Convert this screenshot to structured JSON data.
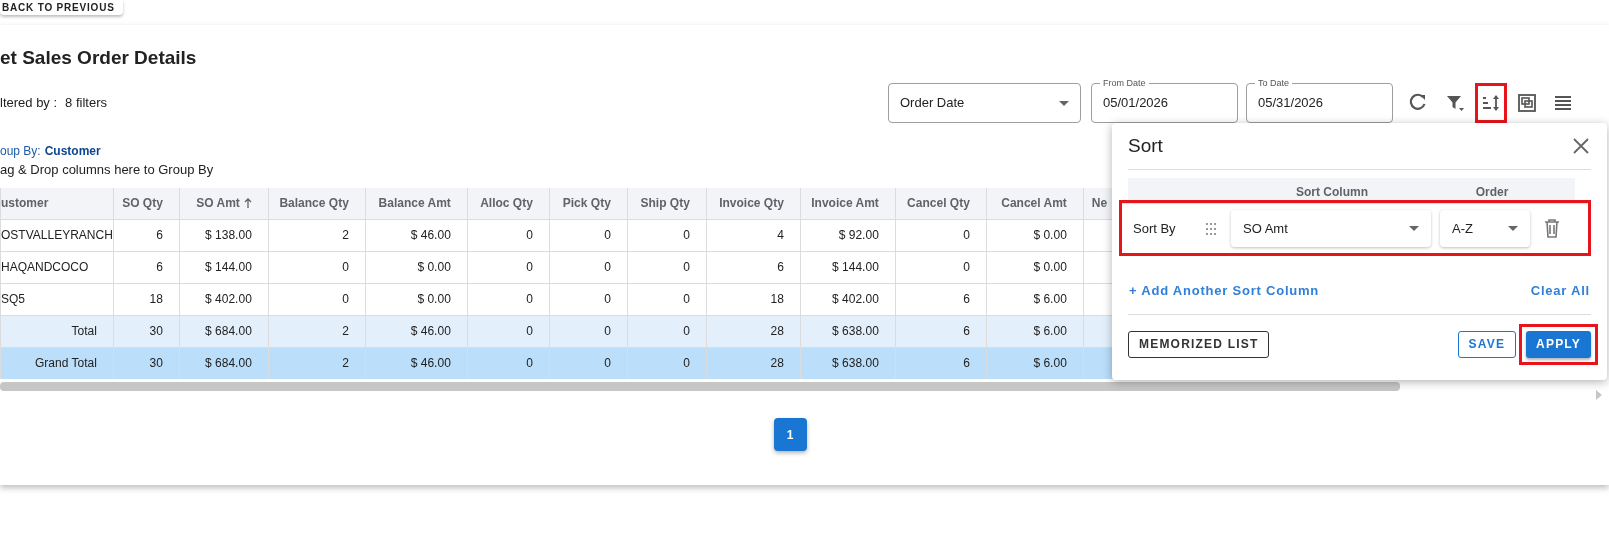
{
  "back_button": "BACK TO PREVIOUS",
  "title": "et Sales Order Details",
  "filter_label": "ltered by :",
  "filter_count": "8 filters",
  "date_field_select": {
    "value": "Order Date"
  },
  "from_date": {
    "label": "From Date",
    "value": "05/01/2026"
  },
  "to_date": {
    "label": "To Date",
    "value": "05/31/2026"
  },
  "toolbar": [
    {
      "kind": "refresh",
      "highlighted": false
    },
    {
      "kind": "filter",
      "highlighted": false
    },
    {
      "kind": "sort",
      "highlighted": true
    },
    {
      "kind": "pivot",
      "highlighted": false
    },
    {
      "kind": "columns",
      "highlighted": false
    }
  ],
  "group_by": {
    "label": "oup By:",
    "value": "Customer"
  },
  "drop_hint": "ag & Drop columns here to Group By",
  "table": {
    "columns": [
      {
        "label": "ustomer",
        "sorted": false
      },
      {
        "label": "SO Qty",
        "sorted": false
      },
      {
        "label": "SO Amt",
        "sorted": true
      },
      {
        "label": "Balance Qty",
        "sorted": false
      },
      {
        "label": "Balance Amt",
        "sorted": false
      },
      {
        "label": "Alloc Qty",
        "sorted": false
      },
      {
        "label": "Pick Qty",
        "sorted": false
      },
      {
        "label": "Ship Qty",
        "sorted": false
      },
      {
        "label": "Invoice Qty",
        "sorted": false
      },
      {
        "label": "Invoice Amt",
        "sorted": false
      },
      {
        "label": "Cancel Qty",
        "sorted": false
      },
      {
        "label": "Cancel Amt",
        "sorted": false
      },
      {
        "label": "Ne",
        "sorted": false
      }
    ],
    "rows": [
      {
        "kind": "data",
        "cells": [
          "OSTVALLEYRANCH",
          "6",
          "$ 138.00",
          "2",
          "$ 46.00",
          "0",
          "0",
          "0",
          "4",
          "$ 92.00",
          "0",
          "$ 0.00"
        ]
      },
      {
        "kind": "data",
        "cells": [
          "HAQANDCOCO",
          "6",
          "$ 144.00",
          "0",
          "$ 0.00",
          "0",
          "0",
          "0",
          "6",
          "$ 144.00",
          "0",
          "$ 0.00"
        ]
      },
      {
        "kind": "data",
        "cells": [
          "SQ5",
          "18",
          "$ 402.00",
          "0",
          "$ 0.00",
          "0",
          "0",
          "0",
          "18",
          "$ 402.00",
          "6",
          "$ 6.00"
        ]
      },
      {
        "kind": "total",
        "cells": [
          "Total",
          "30",
          "$ 684.00",
          "2",
          "$ 46.00",
          "0",
          "0",
          "0",
          "28",
          "$ 638.00",
          "6",
          "$ 6.00"
        ]
      },
      {
        "kind": "grand_total",
        "cells": [
          "Grand Total",
          "30",
          "$ 684.00",
          "2",
          "$ 46.00",
          "0",
          "0",
          "0",
          "28",
          "$ 638.00",
          "6",
          "$ 6.00"
        ]
      }
    ]
  },
  "pagination": [
    {
      "label": "1",
      "selected": true
    }
  ],
  "sort_panel": {
    "title": "Sort",
    "headers": [
      "Sort Column",
      "Order"
    ],
    "rows": [
      {
        "label": "Sort By",
        "column": "SO Amt",
        "order": "A-Z",
        "highlighted": true
      }
    ],
    "add_link": "+ Add Another Sort Column",
    "clear_link": "Clear All",
    "buttons": [
      {
        "label": "MEMORIZED LIST",
        "kind": "outlined",
        "highlighted": false
      },
      {
        "label": "SAVE",
        "kind": "outlined_primary",
        "highlighted": false
      },
      {
        "label": "APPLY",
        "kind": "primary",
        "highlighted": true
      }
    ]
  }
}
